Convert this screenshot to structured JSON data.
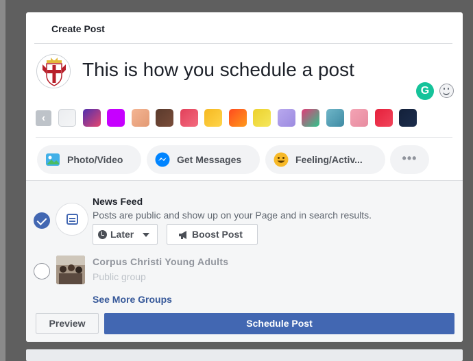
{
  "dialog": {
    "title": "Create Post"
  },
  "composer": {
    "text": "This is how you schedule a post",
    "grammarly_letter": "G"
  },
  "backgrounds": {
    "prev_arrow": "‹",
    "swatches": [
      {
        "name": "plain-white",
        "color": "#ebedf0",
        "color2": "#f5f6f7"
      },
      {
        "name": "purple-blue",
        "color": "#4f2fae",
        "color2": "#e5466e"
      },
      {
        "name": "magenta",
        "color": "#c600ff",
        "color2": "#c600ff"
      },
      {
        "name": "peach",
        "color": "#f4b593",
        "color2": "#e39a74"
      },
      {
        "name": "brown",
        "color": "#5a3a2c",
        "color2": "#7a4d3a"
      },
      {
        "name": "red-pink",
        "color": "#e2405a",
        "color2": "#f36b7f"
      },
      {
        "name": "yellow-orange",
        "color": "#f5b821",
        "color2": "#ffd54a"
      },
      {
        "name": "orange-red",
        "color": "#ff4b1f",
        "color2": "#ff9a1b"
      },
      {
        "name": "yellow",
        "color": "#ecd12c",
        "color2": "#f5e75c"
      },
      {
        "name": "lavender",
        "color": "#b8a8ee",
        "color2": "#9c8be0"
      },
      {
        "name": "pink-green",
        "color": "#e13c78",
        "color2": "#2dc58b"
      },
      {
        "name": "teal",
        "color": "#6fb6c8",
        "color2": "#3e8aa3"
      },
      {
        "name": "light-pink",
        "color": "#f4a3b4",
        "color2": "#e78ca0"
      },
      {
        "name": "red-hearts",
        "color": "#e5203b",
        "color2": "#f2445b"
      },
      {
        "name": "navy",
        "color": "#13203a",
        "color2": "#1c2d4c"
      }
    ]
  },
  "actions": {
    "photo_video": "Photo/Video",
    "get_messages": "Get Messages",
    "feeling": "Feeling/Activ...",
    "more": "•••"
  },
  "audience": {
    "news_feed": {
      "title": "News Feed",
      "description": "Posts are public and show up on your Page and in search results.",
      "schedule_label": "Later",
      "boost_label": "Boost Post"
    },
    "group": {
      "name": "Corpus Christi Young Adults",
      "privacy": "Public group"
    },
    "see_more": "See More Groups"
  },
  "footer": {
    "preview": "Preview",
    "schedule": "Schedule Post"
  },
  "colors": {
    "accent": "#4267b2",
    "link": "#365899",
    "grammarly": "#15c39a"
  }
}
